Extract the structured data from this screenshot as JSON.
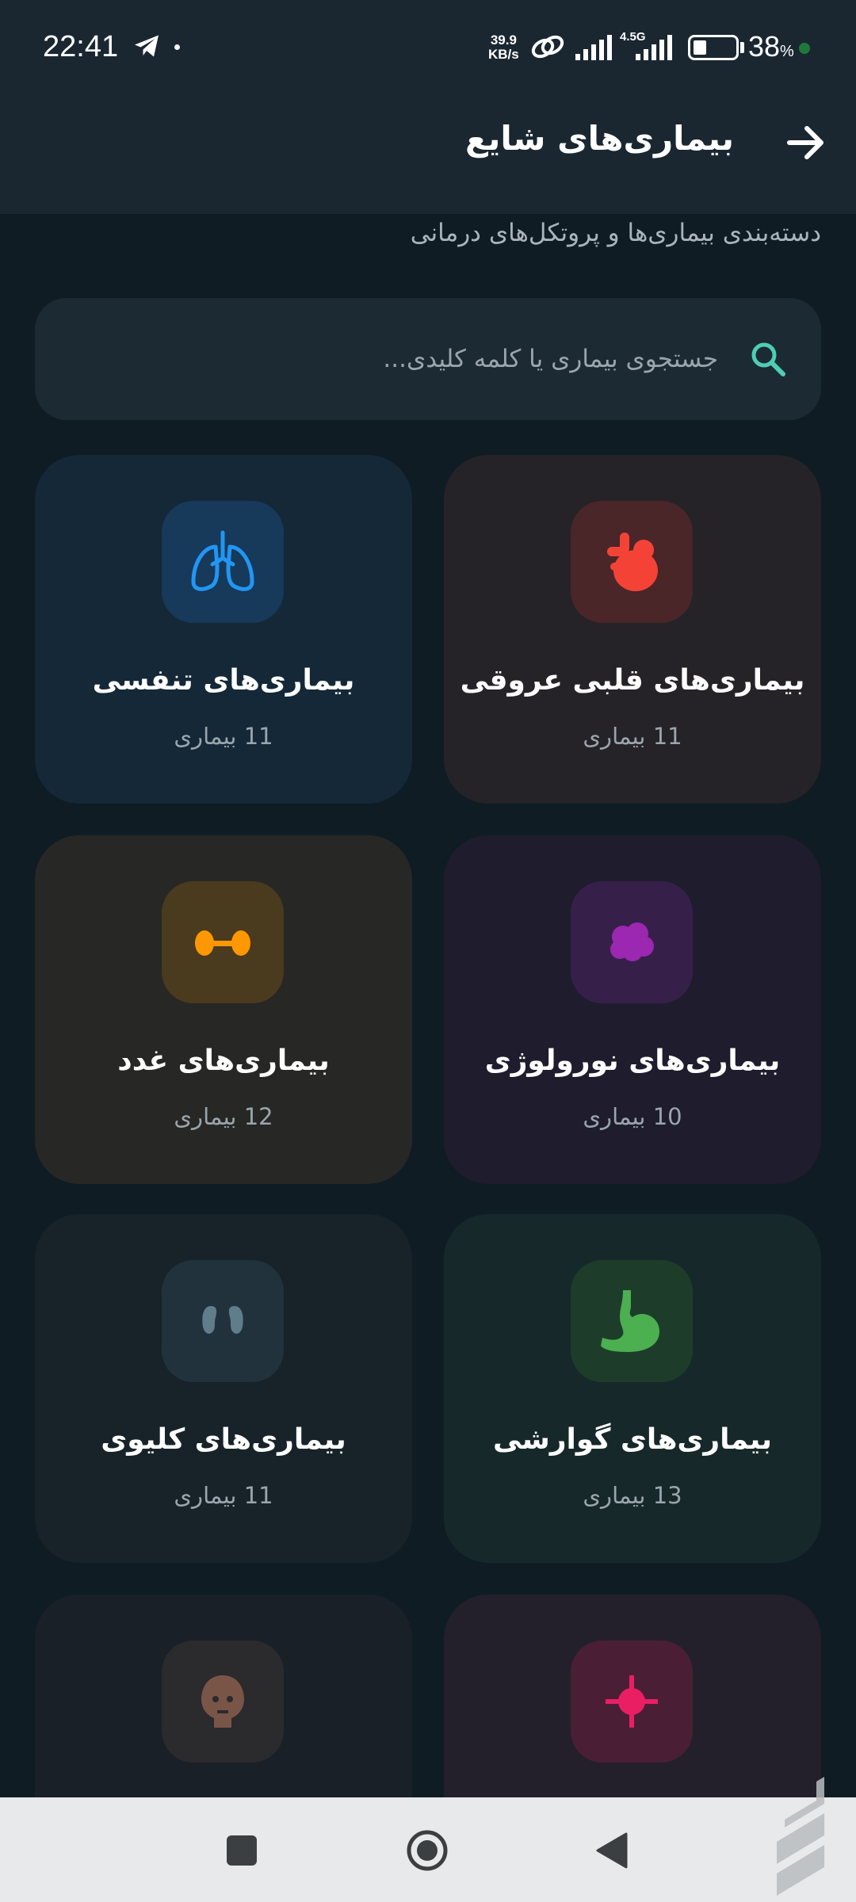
{
  "status_bar": {
    "time": "22:41",
    "speed_value": "39.9",
    "speed_unit": "KB/s",
    "network": "4.5G",
    "battery_percent": "38",
    "battery_symbol": "%"
  },
  "header": {
    "title": "بیماری‌های شایع",
    "subtitle": "دسته‌بندی بیماری‌ها و پروتکل‌های درمانی"
  },
  "search": {
    "placeholder": "جستجوی بیماری یا کلمه کلیدی..."
  },
  "categories": [
    {
      "title": "بیماری‌های قلبی عروقی",
      "count": "11 بیماری",
      "icon": "heart-icon",
      "color": "#f44336"
    },
    {
      "title": "بیماری‌های تنفسی",
      "count": "11 بیماری",
      "icon": "lungs-icon",
      "color": "#2196f3"
    },
    {
      "title": "بیماری‌های نورولوژی",
      "count": "10 بیماری",
      "icon": "brain-icon",
      "color": "#9c27b0"
    },
    {
      "title": "بیماری‌های غدد",
      "count": "12 بیماری",
      "icon": "thyroid-icon",
      "color": "#ff9800"
    },
    {
      "title": "بیماری‌های گوارشی",
      "count": "13 بیماری",
      "icon": "stomach-icon",
      "color": "#4caf50"
    },
    {
      "title": "بیماری‌های کلیوی",
      "count": "11 بیماری",
      "icon": "kidney-icon",
      "color": "#607d8b"
    },
    {
      "title": "",
      "count": "",
      "icon": "virus-icon",
      "color": "#e91e63"
    },
    {
      "title": "",
      "count": "",
      "icon": "face-icon",
      "color": "#795548"
    }
  ]
}
